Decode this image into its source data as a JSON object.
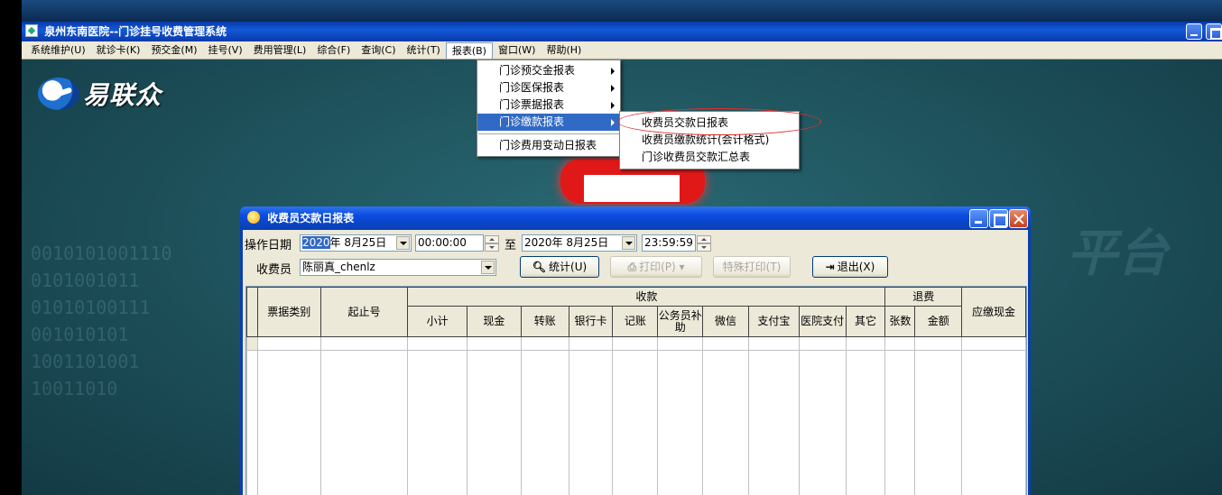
{
  "app": {
    "title": "泉州东南医院--门诊挂号收费管理系统"
  },
  "menubar": {
    "items": [
      "系统维护(U)",
      "就诊卡(K)",
      "预交金(M)",
      "挂号(V)",
      "费用管理(L)",
      "综合(F)",
      "查询(C)",
      "统计(T)",
      "报表(B)",
      "窗口(W)",
      "帮助(H)"
    ],
    "active_index": 8
  },
  "logo": {
    "text": "易联众"
  },
  "report_menu": {
    "items": [
      {
        "label": "门诊预交金报表",
        "submenu": true
      },
      {
        "label": "门诊医保报表",
        "submenu": true
      },
      {
        "label": "门诊票据报表",
        "submenu": true
      },
      {
        "label": "门诊缴款报表",
        "submenu": true,
        "highlighted": true
      },
      {
        "label": "门诊费用变动日报表",
        "submenu": false
      }
    ],
    "submenu_items": [
      "收费员交款日报表",
      "收费员缴款统计(会计格式)",
      "门诊收费员交款汇总表"
    ]
  },
  "dialog": {
    "title": "收费员交款日报表",
    "date_label": "操作日期",
    "from_year": "2020",
    "from_date_rest": "年  8月25日",
    "from_time": "00:00:00",
    "to_label": "至",
    "to_date": "2020年  8月25日",
    "to_time": "23:59:59",
    "cashier_label": "收费员",
    "cashier_value": "陈丽真_chenlz",
    "buttons": {
      "stats": "统计(U)",
      "print": "打印(P)",
      "special_print": "特殊打印(T)",
      "exit": "退出(X)"
    },
    "table": {
      "col_receipt_type": "票据类别",
      "col_range": "起止号",
      "group_collect": "收款",
      "collect_cols": [
        "小计",
        "现金",
        "转账",
        "银行卡",
        "记账",
        "公务员补助",
        "微信",
        "支付宝",
        "医院支付",
        "其它"
      ],
      "group_refund": "退费",
      "refund_cols": [
        "张数",
        "金额"
      ],
      "col_cash_due": "应缴现金"
    }
  },
  "background": {
    "digits": "0010101001110\n0101001011\n01010100111\n001010101\n1001101001\n10011010"
  },
  "colors": {
    "titlebar": "#0a3aa8",
    "desktop": "#1d4f59",
    "menu_highlight": "#316ac5",
    "annotation_ellipse": "#e03030"
  }
}
